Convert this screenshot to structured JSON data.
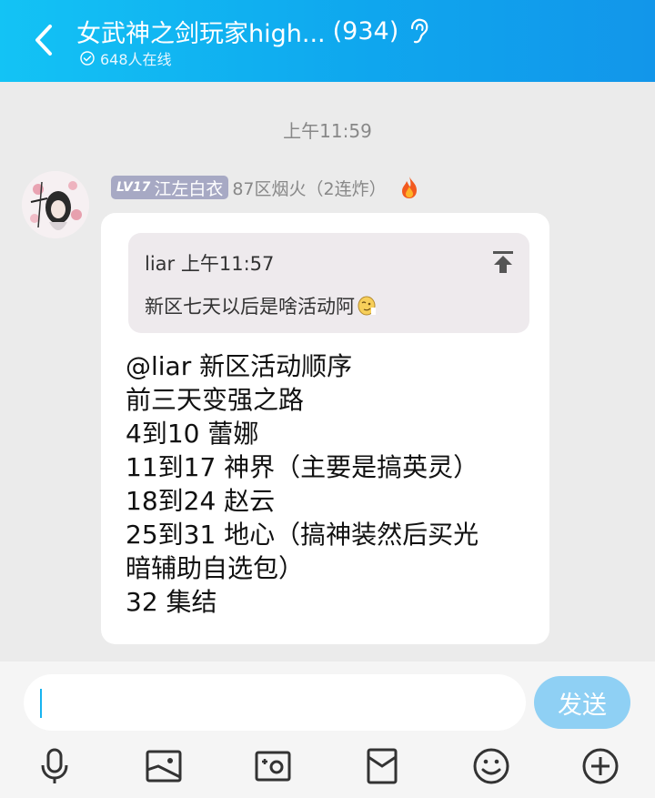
{
  "header": {
    "title": "女武神之剑玩家high...",
    "member_count": "(934)",
    "online": "648人在线"
  },
  "chat": {
    "time_separator": "上午11:59",
    "message": {
      "level_badge": "LV17",
      "sender_nick": "江左白衣",
      "sender_group": "87区烟火（2连炸）",
      "quote": {
        "author_time": "liar 上午11:57",
        "text": "新区七天以后是啥活动阿"
      },
      "lines": [
        "@liar 新区活动顺序",
        "前三天变强之路",
        "4到10 蕾娜",
        "11到17 神界（主要是搞英灵）",
        "18到24 赵云",
        "25到31 地心（搞神装然后买光",
        "暗辅助自选包）",
        "32 集结"
      ]
    }
  },
  "input": {
    "value": "",
    "send_label": "发送"
  },
  "colors": {
    "header_start": "#13c3f5",
    "header_end": "#1296ea",
    "send_button": "#8fd0f4",
    "level_badge": "#a7a9c4"
  },
  "icons": [
    "back-arrow-icon",
    "ear-icon",
    "check-circle-icon",
    "fire-icon",
    "scroll-to-quote-icon",
    "emoji-face-icon",
    "microphone-icon",
    "image-icon",
    "camera-icon",
    "red-packet-icon",
    "emoji-icon",
    "plus-icon"
  ]
}
